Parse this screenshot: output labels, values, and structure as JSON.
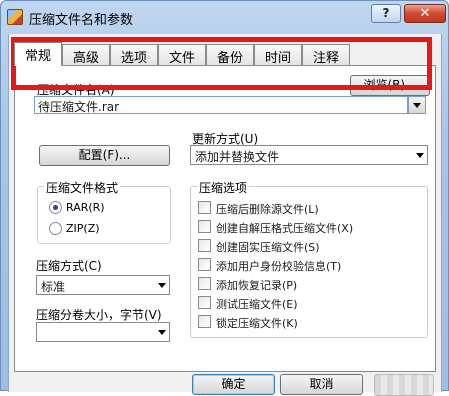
{
  "window": {
    "title": "压缩文件名和参数",
    "help": "?",
    "close": "✕"
  },
  "tabs": [
    "常规",
    "高级",
    "选项",
    "文件",
    "备份",
    "时间",
    "注释"
  ],
  "archive_name": {
    "label": "压缩文件名(A)",
    "browse": "浏览(B)...",
    "value": "待压缩文件.rar"
  },
  "profiles_button": "配置(F)...",
  "update_mode": {
    "label": "更新方式(U)",
    "value": "添加并替换文件"
  },
  "format": {
    "label": "压缩文件格式",
    "options": [
      "RAR(R)",
      "ZIP(Z)"
    ],
    "selected": "RAR(R)"
  },
  "method": {
    "label": "压缩方式(C)",
    "value": "标准"
  },
  "split": {
    "label": "压缩分卷大小，字节(V)",
    "value": ""
  },
  "options": {
    "label": "压缩选项",
    "items": [
      "压缩后删除源文件(L)",
      "创建自解压格式压缩文件(X)",
      "创建固实压缩文件(S)",
      "添加用户身份校验信息(T)",
      "添加恢复记录(P)",
      "测试压缩文件(E)",
      "锁定压缩文件(K)"
    ]
  },
  "footer": {
    "ok": "确定",
    "cancel": "取消"
  }
}
